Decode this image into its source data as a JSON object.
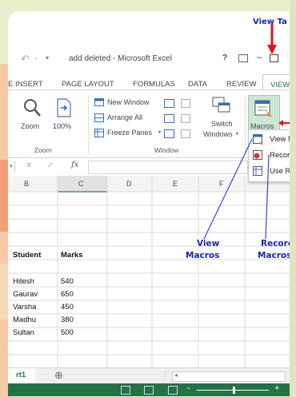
{
  "window": {
    "title": "add deleted - Microsoft Excel",
    "controls": {
      "help": "?",
      "minimize": "–"
    }
  },
  "quick_access": {
    "undo_symbol": "↶",
    "customize_symbol": "▾"
  },
  "tabs": [
    {
      "label": "E INSERT",
      "active": false
    },
    {
      "label": "PAGE LAYOUT",
      "active": false
    },
    {
      "label": "FORMULAS",
      "active": false
    },
    {
      "label": "DATA",
      "active": false
    },
    {
      "label": "REVIEW",
      "active": false
    },
    {
      "label": "VIEW",
      "active": true
    }
  ],
  "ribbon": {
    "zoom_group": {
      "label": "Zoom",
      "zoom_button": "Zoom",
      "zoom100_button": "100%"
    },
    "window_group": {
      "label": "Window",
      "new_window": "New Window",
      "arrange_all": "Arrange All",
      "freeze_panes": "Freeze Panes",
      "switch_windows_line1": "Switch",
      "switch_windows_line2": "Windows"
    },
    "macros_group": {
      "macros_button": "Macros"
    }
  },
  "macros_menu": {
    "items": [
      {
        "label": "View M",
        "icon": "view-macros-icon"
      },
      {
        "label": "Record",
        "icon": "record-macro-icon"
      },
      {
        "label": "Use Rel",
        "icon": "relative-references-icon"
      }
    ]
  },
  "formula_bar": {
    "fx_label": "fx",
    "cancel_symbol": "✕",
    "enter_symbol": "✓"
  },
  "columns": [
    "B",
    "C",
    "D",
    "E",
    "F"
  ],
  "sheet": {
    "headers": {
      "student": "Student",
      "marks": "Marks"
    },
    "rows": [
      {
        "student": "Hitesh",
        "marks": "540"
      },
      {
        "student": "Gaurav",
        "marks": "650"
      },
      {
        "student": "Varsha",
        "marks": "450"
      },
      {
        "student": "Madhu",
        "marks": "380"
      },
      {
        "student": "Sultan",
        "marks": "500"
      }
    ]
  },
  "sheet_tabs": {
    "active_tab": "rt1",
    "add_symbol": "⊕"
  },
  "annotations": {
    "view_tab": "View Ta",
    "view_macros_line1": "View",
    "view_macros_line2": "Macros",
    "record_macros_line1": "Record",
    "record_macros_line2": "Macros"
  },
  "colors": {
    "excel_green": "#217346",
    "annotation_blue": "#1a25b5",
    "arrow_red": "#e2131d",
    "selection_green": "#1e7a45"
  },
  "status_bar": {
    "zoom_minus": "-",
    "zoom_plus": "+"
  }
}
